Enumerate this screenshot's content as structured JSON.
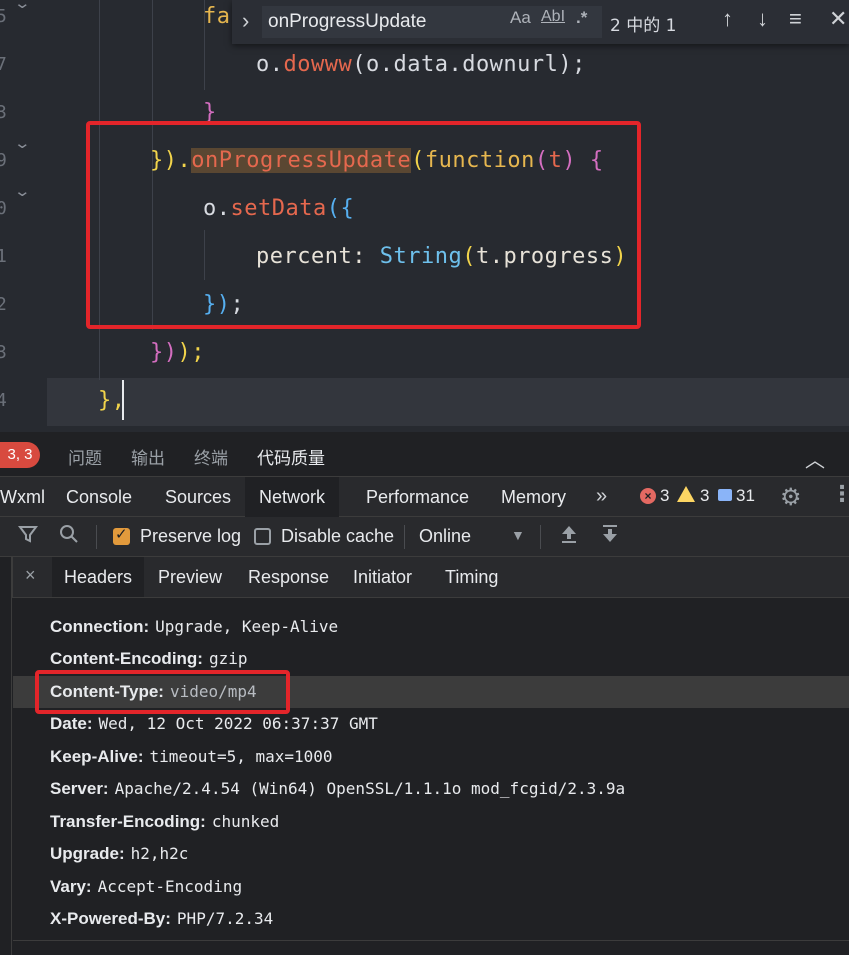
{
  "editor": {
    "line_numbers": [
      "5",
      "7",
      "3",
      "9",
      "0",
      "1",
      "2",
      "3",
      "4"
    ],
    "lines": {
      "l0": "fa",
      "l1_obj": "o.",
      "l1_method": "dowww",
      "l1_rest": "(o.data.downurl);",
      "l2": "}",
      "l3_open": "}).",
      "l3_method": "onProgressUpdate",
      "l3_paren": "(",
      "l3_fn": "function",
      "l3_paren2": "(",
      "l3_param": "t",
      "l3_close": ") {",
      "l4_obj": "o.",
      "l4_method": "setData",
      "l4_open": "({",
      "l5_prop": "percent: ",
      "l5_builtin": "String",
      "l5_open": "(",
      "l5_arg": "t.progress",
      "l5_close": ")",
      "l6_close": "})",
      "l6_semi": ";",
      "l7_a": "})",
      "l7_b": ");",
      "l8": "},"
    }
  },
  "find_widget": {
    "query": "onProgressUpdate",
    "case_label": "Aa",
    "word_label": "AbI",
    "regex_label": ".*",
    "result_count": "2 中的 1"
  },
  "panel_tabs": {
    "error_badge": "3, 3",
    "tabs": [
      "问题",
      "输出",
      "终端",
      "代码质量"
    ]
  },
  "devtools_tabs": {
    "tabs": [
      "Wxml",
      "Console",
      "Sources",
      "Network",
      "Performance",
      "Memory"
    ],
    "active": "Network",
    "more": "»",
    "errors": "3",
    "warnings": "3",
    "messages": "31"
  },
  "network_toolbar": {
    "preserve_log": "Preserve log",
    "disable_cache": "Disable cache",
    "throttling": "Online"
  },
  "detail_tabs": {
    "close": "×",
    "tabs": [
      "Headers",
      "Preview",
      "Response",
      "Initiator",
      "Timing"
    ],
    "active": "Headers"
  },
  "headers": [
    {
      "name": "Connection:",
      "value": "Upgrade, Keep-Alive"
    },
    {
      "name": "Content-Encoding:",
      "value": "gzip"
    },
    {
      "name": "Content-Type:",
      "value": "video/mp4"
    },
    {
      "name": "Date:",
      "value": "Wed, 12 Oct 2022 06:37:37 GMT"
    },
    {
      "name": "Keep-Alive:",
      "value": "timeout=5, max=1000"
    },
    {
      "name": "Server:",
      "value": "Apache/2.4.54 (Win64) OpenSSL/1.1.1o mod_fcgid/2.3.9a"
    },
    {
      "name": "Transfer-Encoding:",
      "value": "chunked"
    },
    {
      "name": "Upgrade:",
      "value": "h2,h2c"
    },
    {
      "name": "Vary:",
      "value": "Accept-Encoding"
    },
    {
      "name": "X-Powered-By:",
      "value": "PHP/7.2.34"
    }
  ],
  "colors": {
    "annotation": "#e3252a",
    "accent_checkbox": "#e29a3c",
    "error_badge": "#d84a3f"
  }
}
